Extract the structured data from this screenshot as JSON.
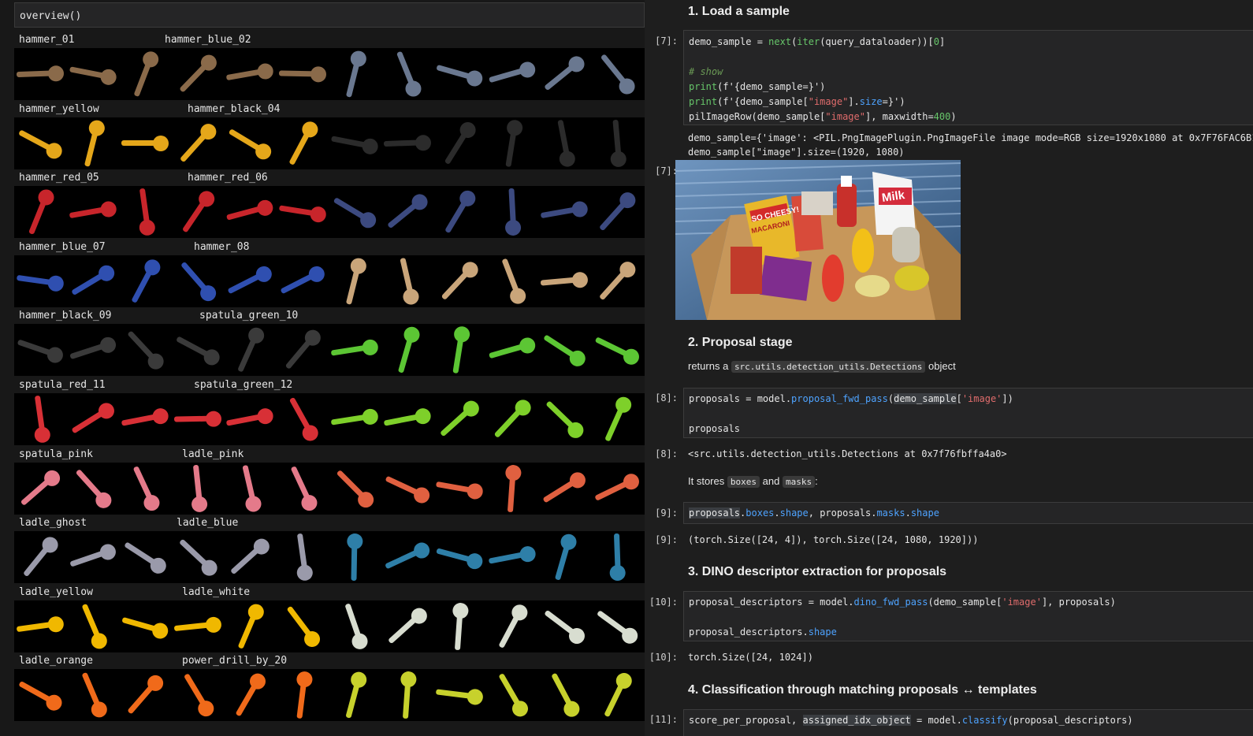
{
  "left": {
    "cell_title": "overview()",
    "rows": [
      {
        "labels": [
          "hammer_01",
          "hammer_blue_02"
        ],
        "label_x": [
          24,
          209
        ]
      },
      {
        "labels": [
          "hammer_yellow",
          "hammer_black_04"
        ],
        "label_x": [
          24,
          238
        ]
      },
      {
        "labels": [
          "hammer_red_05",
          "hammer_red_06"
        ],
        "label_x": [
          24,
          238
        ]
      },
      {
        "labels": [
          "hammer_blue_07",
          "hammer_08"
        ],
        "label_x": [
          24,
          246
        ]
      },
      {
        "labels": [
          "hammer_black_09",
          "spatula_green_10"
        ],
        "label_x": [
          24,
          253
        ]
      },
      {
        "labels": [
          "spatula_red_11",
          "spatula_green_12"
        ],
        "label_x": [
          24,
          246
        ]
      },
      {
        "labels": [
          "spatula_pink",
          "ladle_pink"
        ],
        "label_x": [
          24,
          231
        ]
      },
      {
        "labels": [
          "ladle_ghost",
          "ladle_blue"
        ],
        "label_x": [
          24,
          224
        ]
      },
      {
        "labels": [
          "ladle_yellow",
          "ladle_white"
        ],
        "label_x": [
          24,
          231
        ]
      },
      {
        "labels": [
          "ladle_orange",
          "power_drill_by_20"
        ],
        "label_x": [
          24,
          231
        ]
      }
    ],
    "strip_colors": [
      [
        "#8a6a4a",
        "#6a7890"
      ],
      [
        "#e5a71a",
        "#2b2b2b"
      ],
      [
        "#c8252b",
        "#3c4a80"
      ],
      [
        "#2f4fb0",
        "#c9a57a"
      ],
      [
        "#3a3a3a",
        "#5cc634"
      ],
      [
        "#d83036",
        "#7ed02a"
      ],
      [
        "#e47a8a",
        "#e06040"
      ],
      [
        "#9a9aaa",
        "#2e7fa8"
      ],
      [
        "#f0b800",
        "#d8ddd0"
      ],
      [
        "#f06a1a",
        "#c7d12c"
      ]
    ]
  },
  "right": {
    "h1": "1. Load a sample",
    "p7a": "[7]:",
    "c7": {
      "l1a": "demo_sample = ",
      "l1b": "next",
      "l1c": "(",
      "l1d": "iter",
      "l1e": "(query_dataloader))[",
      "l1f": "0",
      "l1g": "]",
      "l2": "# show",
      "l3a": "print",
      "l3b": "(f'{demo_sample=}')",
      "l4a": "print",
      "l4b": "(f'{demo_sample[",
      "l4c": "\"image\"",
      "l4d": "].",
      "l4e": "size",
      "l4f": "=}')",
      "l5a": "pilImageRow(demo_sample[",
      "l5b": "\"image\"",
      "l5c": "], maxwidth=",
      "l5d": "400",
      "l5e": ")"
    },
    "o7a": "demo_sample={'image': <PIL.PngImagePlugin.PngImageFile image mode=RGB size=1920x1080 at 0x7F76FAC6B190>,",
    "o7b": "demo_sample[\"image\"].size=(1920, 1080)",
    "p7b": "[7]:",
    "h2": "2. Proposal stage",
    "returns_a": "returns a",
    "returns_code": "src.utils.detection_utils.Detections",
    "returns_b": "object",
    "p8a": "[8]:",
    "c8": {
      "a": "proposals = model.",
      "b": "proposal_fwd_pass",
      "c": "(",
      "d": "demo_sample",
      "e": "[",
      "f": "'image'",
      "g": "])",
      "l2": "proposals"
    },
    "p8b": "[8]:",
    "o8": "<src.utils.detection_utils.Detections at 0x7f76fbffa4a0>",
    "stores_a": "It stores",
    "stores_code1": "boxes",
    "stores_and": "and",
    "stores_code2": "masks",
    "stores_b": ":",
    "p9a": "[9]:",
    "c9": {
      "a": "proposals",
      "b": ".",
      "c": "boxes",
      "d": ".",
      "e": "shape",
      "f": ", proposals.",
      "g": "masks",
      "h": ".",
      "i": "shape"
    },
    "p9b": "[9]:",
    "o9": "(torch.Size([24, 4]), torch.Size([24, 1080, 1920]))",
    "h3": "3. DINO descriptor extraction for proposals",
    "p10a": "[10]:",
    "c10": {
      "a": "proposal_descriptors = model.",
      "b": "dino_fwd_pass",
      "c": "(demo_sample[",
      "d": "'image'",
      "e": "], proposals)",
      "l2a": "proposal_descriptors.",
      "l2b": "shape"
    },
    "p10b": "[10]:",
    "o10": "torch.Size([24, 1024])",
    "h4": "4. Classification through matching proposals ↔ templates",
    "p11": "[11]:",
    "c11": {
      "a": "score_per_proposal, ",
      "b": "assigned_idx_object",
      "c": " = model.",
      "d": "classify",
      "e": "(proposal_descriptors)"
    },
    "photo": {
      "alt": "cardboard box with groceries",
      "labels": [
        "SO CHEESY!",
        "MACARONI",
        "Milk"
      ]
    }
  }
}
